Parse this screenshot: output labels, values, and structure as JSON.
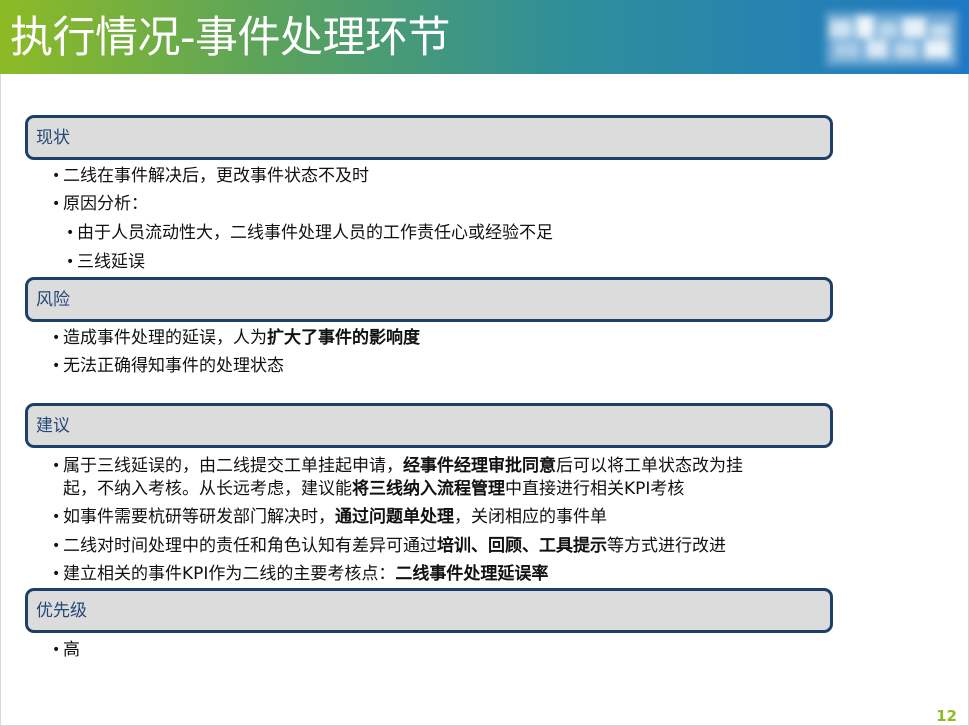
{
  "title": "执行情况-事件处理环节",
  "sections": [
    {
      "label": "现状",
      "items": [
        {
          "parts": [
            {
              "text": "二线在事件解决后，更改事件状态不及时",
              "bold": false
            }
          ]
        },
        {
          "parts": [
            {
              "text": "原因分析：",
              "bold": false
            }
          ]
        },
        {
          "parts": [
            {
              "text": "由于人员流动性大，二线事件处理人员的工作责任心或经验不足",
              "bold": false
            }
          ]
        },
        {
          "parts": [
            {
              "text": "三线延误",
              "bold": false
            }
          ]
        }
      ]
    },
    {
      "label": "风险",
      "items": [
        {
          "parts": [
            {
              "text": "造成事件处理的延误，人为",
              "bold": false
            },
            {
              "text": "扩大了事件的影响度",
              "bold": true
            }
          ]
        },
        {
          "parts": [
            {
              "text": "无法正确得知事件的处理状态",
              "bold": false
            }
          ]
        }
      ]
    },
    {
      "label": "建议",
      "items": [
        {
          "parts": [
            {
              "text": "属于三线延误的，由二线提交工单挂起申请，",
              "bold": false
            },
            {
              "text": "经事件经理审批同意",
              "bold": true
            },
            {
              "text": "后可以将工单状态改为挂",
              "bold": false
            }
          ]
        },
        {
          "parts": [
            {
              "text": "起，不纳入考核。从长远考虑，建议能",
              "bold": false
            },
            {
              "text": "将三线纳入流程管理",
              "bold": true
            },
            {
              "text": "中直接进行相关KPI考核",
              "bold": false
            }
          ]
        },
        {
          "parts": [
            {
              "text": "如事件需要杭研等研发部门解决时，",
              "bold": false
            },
            {
              "text": "通过问题单处理",
              "bold": true
            },
            {
              "text": "，关闭相应的事件单",
              "bold": false
            }
          ]
        },
        {
          "parts": [
            {
              "text": "二线对时间处理中的责任和角色认知有差异可通过",
              "bold": false
            },
            {
              "text": "培训、回顾、工具提示",
              "bold": true
            },
            {
              "text": "等方式进行改进",
              "bold": false
            }
          ]
        },
        {
          "parts": [
            {
              "text": "建立相关的事件KPI作为二线的主要考核点：",
              "bold": false
            },
            {
              "text": "二线事件处理延误率",
              "bold": true
            }
          ]
        }
      ]
    },
    {
      "label": "优先级",
      "items": [
        {
          "parts": [
            {
              "text": "高",
              "bold": false
            }
          ]
        }
      ]
    }
  ],
  "page_number": "12",
  "colors": {
    "box_border": "#1f3f6b",
    "box_fill": "#dcdcdc",
    "section_label": "#24477a",
    "page_number": "#8dbb25"
  }
}
